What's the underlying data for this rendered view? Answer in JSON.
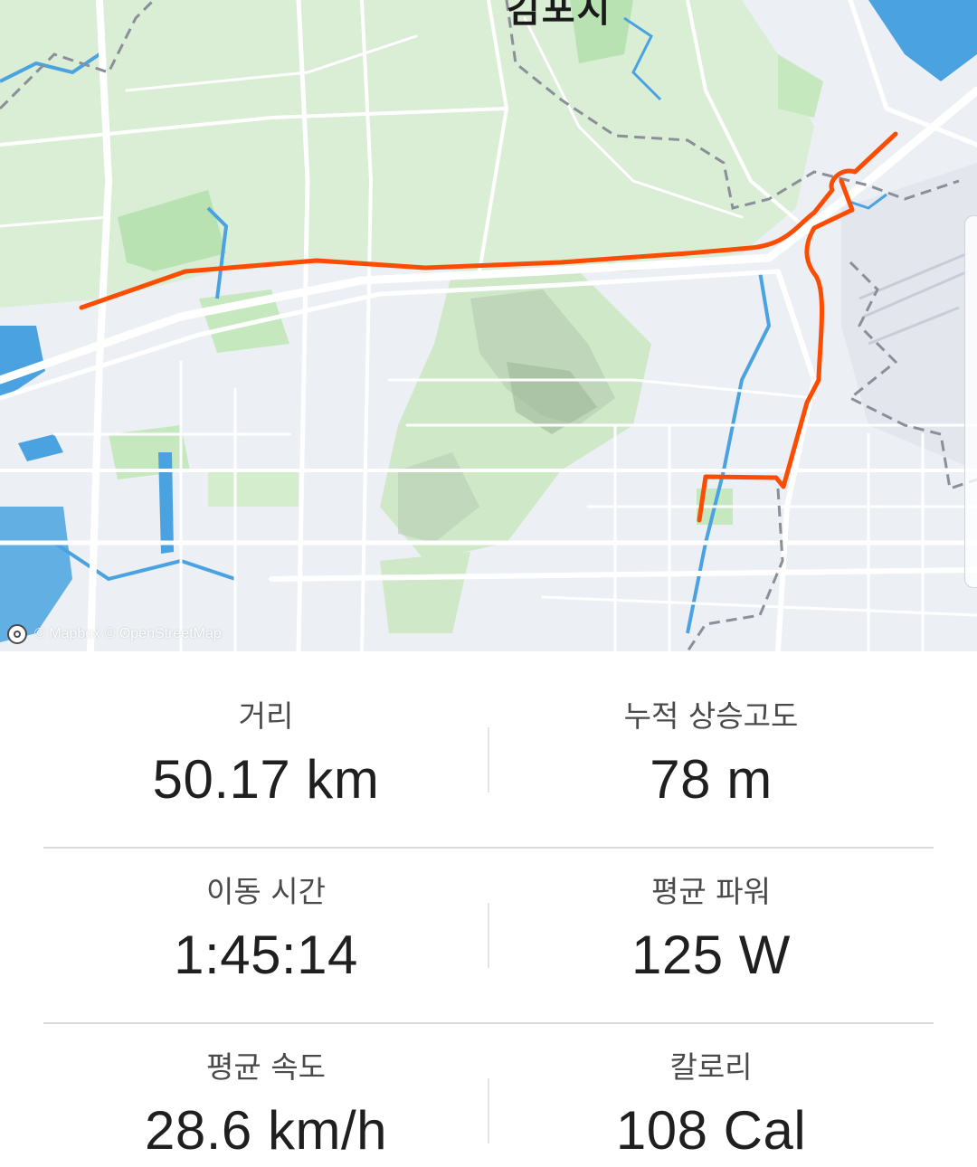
{
  "map": {
    "city_label": "김포시",
    "attribution": "© Mapbox © OpenStreetMap",
    "colors": {
      "background": "#eceff4",
      "land_green": "#d9eed5",
      "park_green": "#b9e2b2",
      "water": "#4aa3e0",
      "roads": "#ffffff",
      "boundary": "#8a8f99",
      "route": "#fc4c02"
    }
  },
  "stats": {
    "distance": {
      "label": "거리",
      "value": "50.17 km"
    },
    "elevation_gain": {
      "label": "누적 상승고도",
      "value": "78 m"
    },
    "moving_time": {
      "label": "이동 시간",
      "value": "1:45:14"
    },
    "avg_power": {
      "label": "평균 파워",
      "value": "125 W"
    },
    "avg_speed": {
      "label": "평균 속도",
      "value": "28.6 km/h"
    },
    "calories": {
      "label": "칼로리",
      "value": "108 Cal"
    }
  }
}
